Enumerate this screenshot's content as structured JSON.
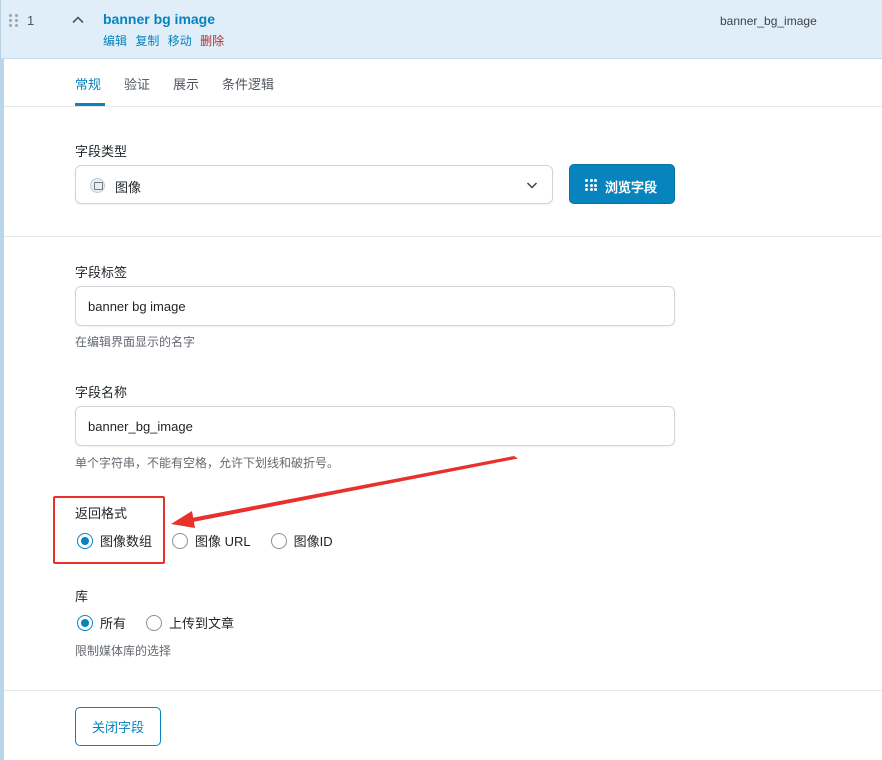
{
  "field": {
    "order": "1",
    "title": "banner bg image",
    "key": "banner_bg_image",
    "actions": {
      "edit": "编辑",
      "duplicate": "复制",
      "move": "移动",
      "delete": "删除"
    }
  },
  "tabs": [
    {
      "label": "常规",
      "active": true
    },
    {
      "label": "验证"
    },
    {
      "label": "展示"
    },
    {
      "label": "条件逻辑"
    }
  ],
  "field_type": {
    "label": "字段类型",
    "value": "图像",
    "icon": "image-icon",
    "browse_button": "浏览字段"
  },
  "field_label": {
    "label": "字段标签",
    "value": "banner bg image",
    "hint": "在编辑界面显示的名字"
  },
  "field_name": {
    "label": "字段名称",
    "value": "banner_bg_image",
    "hint": "单个字符串，不能有空格，允许下划线和破折号。"
  },
  "return_format": {
    "label": "返回格式",
    "options": [
      "图像数组",
      "图像 URL",
      "图像ID"
    ],
    "selected": "图像数组"
  },
  "library": {
    "label": "库",
    "options": [
      "所有",
      "上传到文章"
    ],
    "selected": "所有",
    "hint": "限制媒体库的选择"
  },
  "close_button": "关闭字段",
  "colors": {
    "accent": "#0783be",
    "danger": "#b32d2e",
    "annotation": "#e8312c",
    "header_bg": "#dfeef8"
  }
}
